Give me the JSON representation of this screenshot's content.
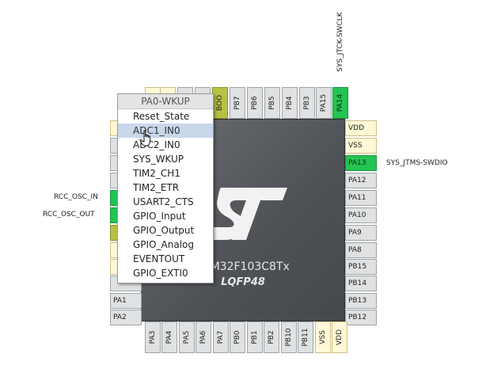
{
  "chip": {
    "part": "STM32F103C8Tx",
    "package": "LQFP48"
  },
  "top_pins": [
    {
      "label": "PA15",
      "state": "default"
    },
    {
      "label": "PA14",
      "state": "assigned"
    }
  ],
  "top_pins_hidden": [
    "BOO",
    "PB7",
    "PB6",
    "PB5",
    "PB4",
    "PB3"
  ],
  "right_pins": [
    {
      "label": "VDD",
      "state": "power"
    },
    {
      "label": "VSS",
      "state": "power"
    },
    {
      "label": "PA13",
      "state": "assigned"
    },
    {
      "label": "PA12",
      "state": "default"
    },
    {
      "label": "PA11",
      "state": "default"
    },
    {
      "label": "PA10",
      "state": "default"
    },
    {
      "label": "PA9",
      "state": "default"
    },
    {
      "label": "PA8",
      "state": "default"
    },
    {
      "label": "PB15",
      "state": "default"
    },
    {
      "label": "PB14",
      "state": "default"
    },
    {
      "label": "PB13",
      "state": "default"
    },
    {
      "label": "PB12",
      "state": "default"
    }
  ],
  "bottom_pins": [
    {
      "label": "PA3",
      "state": "default"
    },
    {
      "label": "PA4",
      "state": "default"
    },
    {
      "label": "PA5",
      "state": "default"
    },
    {
      "label": "PA6",
      "state": "default"
    },
    {
      "label": "PA7",
      "state": "default"
    },
    {
      "label": "PB0",
      "state": "default"
    },
    {
      "label": "PB1",
      "state": "default"
    },
    {
      "label": "PB2",
      "state": "default"
    },
    {
      "label": "PB10",
      "state": "default"
    },
    {
      "label": "PB11",
      "state": "default"
    },
    {
      "label": "VSS",
      "state": "power"
    },
    {
      "label": "VDD",
      "state": "power"
    }
  ],
  "left_pins_visible": [
    {
      "label": "PA1",
      "state": "default"
    },
    {
      "label": "PA2",
      "state": "default"
    }
  ],
  "signals": {
    "pa14": "SYS_JTCK-SWCLK",
    "pa13": "SYS_JTMS-SWDIO",
    "osc_in": "RCC_OSC_IN",
    "osc_out": "RCC_OSC_OUT"
  },
  "context_menu": {
    "title": "PA0-WKUP",
    "items": [
      "Reset_State",
      "ADC1_IN0",
      "ADC2_IN0",
      "SYS_WKUP",
      "TIM2_CH1",
      "TIM2_ETR",
      "USART2_CTS",
      "GPIO_Input",
      "GPIO_Output",
      "GPIO_Analog",
      "EVENTOUT",
      "GPIO_EXTI0"
    ],
    "highlighted": "ADC1_IN0"
  },
  "colors": {
    "assigned_pin": "#23c552",
    "power_pin": "#fff8d6",
    "default_pin": "#dfe1e2",
    "chip_body": "#55585c",
    "menu_highlight": "#c9d7ea"
  }
}
